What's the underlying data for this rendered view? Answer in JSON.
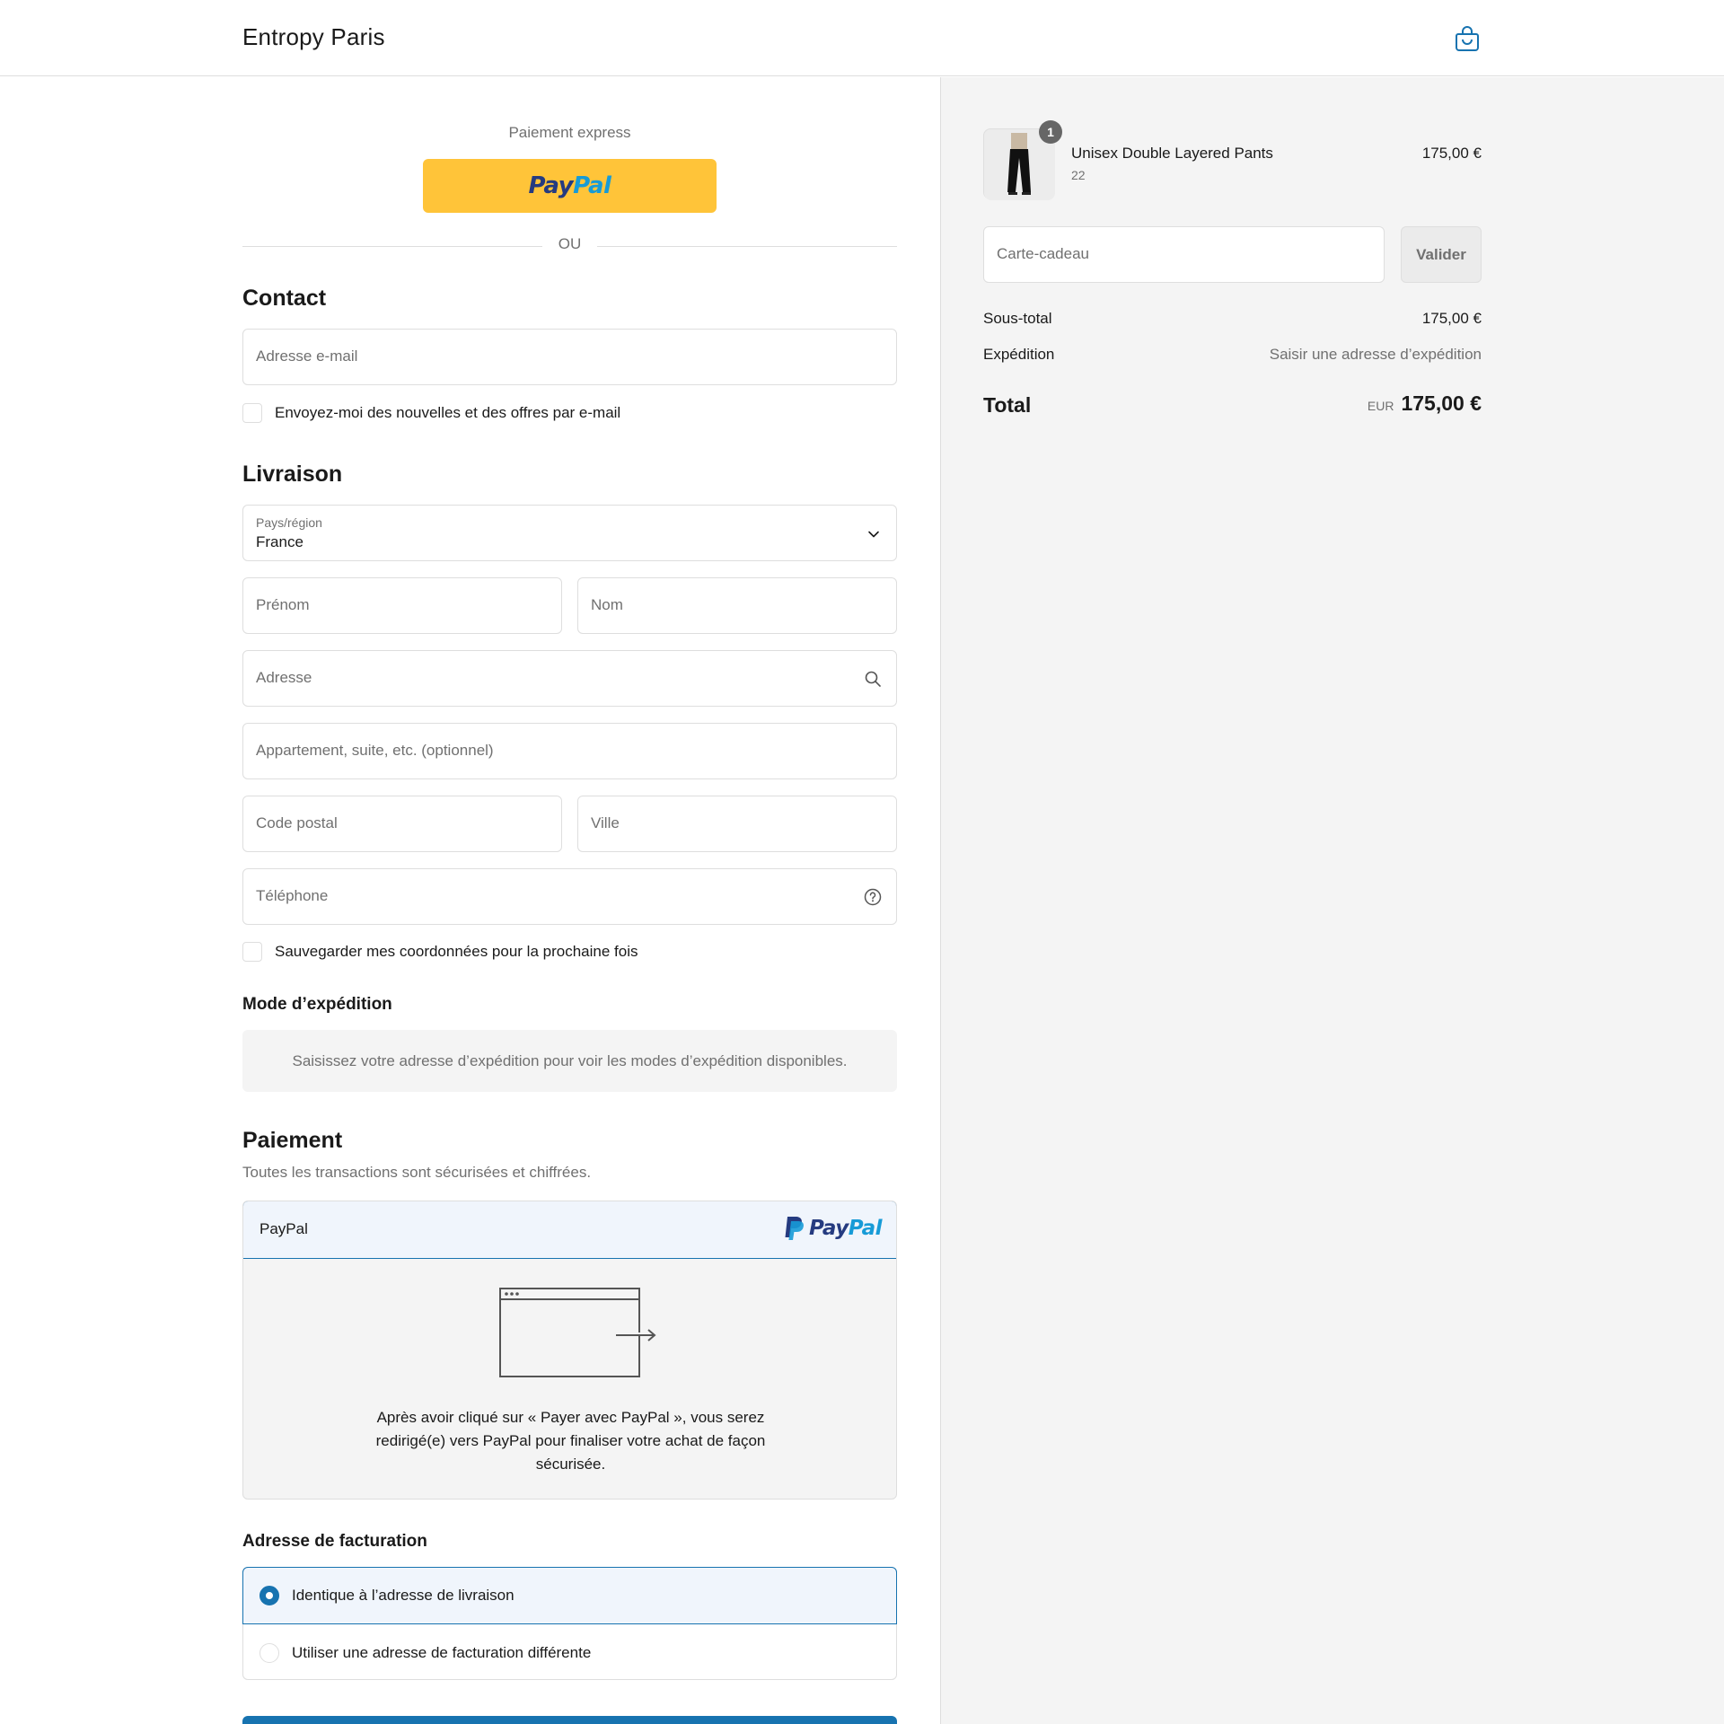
{
  "header": {
    "brand": "Entropy Paris",
    "cart_icon": "shopping-bag-icon"
  },
  "express": {
    "title": "Paiement express",
    "paypal_pay": "Pay",
    "paypal_pal": "Pal",
    "separator": "OU"
  },
  "contact": {
    "title": "Contact",
    "email_placeholder": "Adresse e-mail",
    "newsletter_label": "Envoyez-moi des nouvelles et des offres par e-mail"
  },
  "delivery": {
    "title": "Livraison",
    "country_label": "Pays/région",
    "country_value": "France",
    "first_name_placeholder": "Prénom",
    "last_name_placeholder": "Nom",
    "address_placeholder": "Adresse",
    "apartment_placeholder": "Appartement, suite, etc. (optionnel)",
    "postal_placeholder": "Code postal",
    "city_placeholder": "Ville",
    "phone_placeholder": "Téléphone",
    "save_label": "Sauvegarder mes coordonnées pour la prochaine fois"
  },
  "shipping": {
    "title": "Mode d’expédition",
    "notice": "Saisissez votre adresse d’expédition pour voir les modes d’expédition disponibles."
  },
  "payment": {
    "title": "Paiement",
    "subtitle": "Toutes les transactions sont sécurisées et chiffrées.",
    "method_label": "PayPal",
    "logo_pay": "Pay",
    "logo_pal": "Pal",
    "redirect_text": "Après avoir cliqué sur « Payer avec PayPal », vous serez redirigé(e) vers PayPal pour finaliser votre achat de façon sécurisée."
  },
  "billing": {
    "title": "Adresse de facturation",
    "option_same": "Identique à l’adresse de livraison",
    "option_different": "Utiliser une adresse de facturation différente",
    "selected": "same"
  },
  "order": {
    "item": {
      "name": "Unisex Double Layered Pants",
      "variant": "22",
      "price": "175,00 €",
      "quantity": "1"
    },
    "gift_placeholder": "Carte-cadeau",
    "gift_button": "Valider",
    "subtotal_label": "Sous-total",
    "subtotal_value": "175,00 €",
    "shipping_label": "Expédition",
    "shipping_value": "Saisir une adresse d’expédition",
    "total_label": "Total",
    "total_currency": "EUR",
    "total_value": "175,00 €"
  },
  "colors": {
    "accent": "#1773b0",
    "paypal_yellow": "#ffc439",
    "paypal_dark": "#253b80",
    "paypal_light": "#179bd7",
    "panel_bg": "#f4f4f4"
  }
}
